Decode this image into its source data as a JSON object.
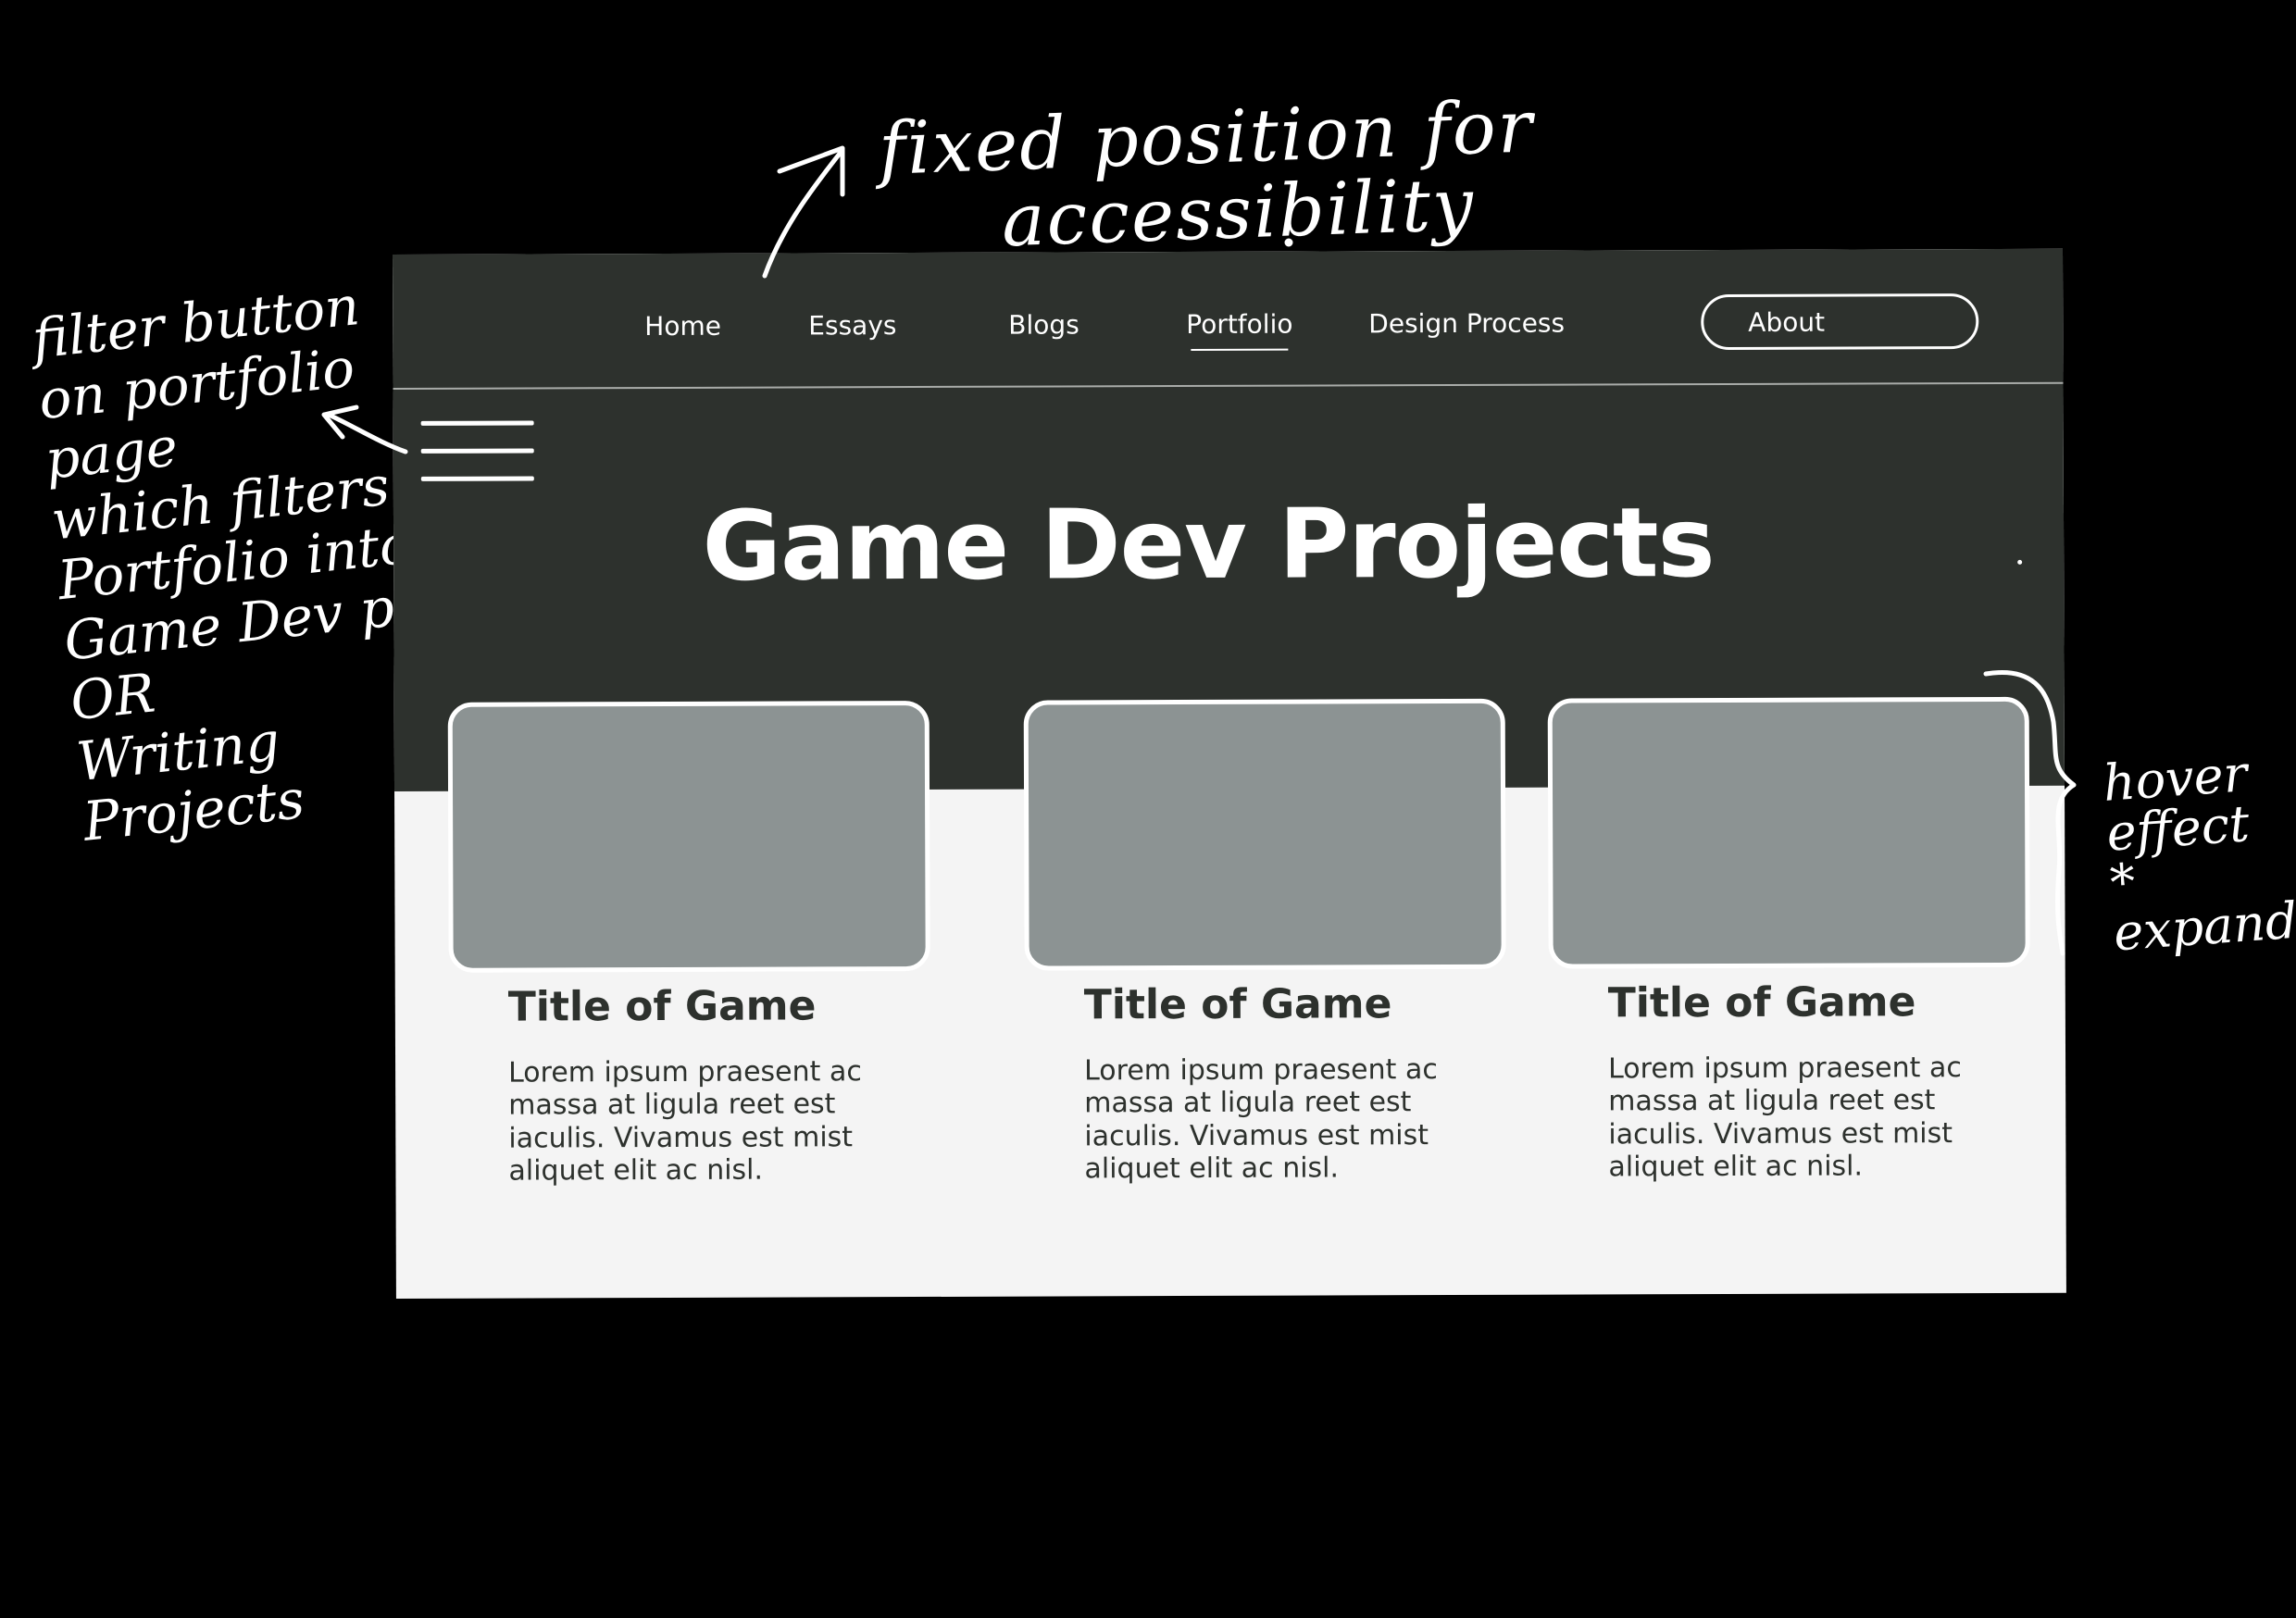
{
  "annotations": {
    "top_line1": "fixed position for",
    "top_line2": "accessibility",
    "left": "filter button\non portfolio\npage\nwhich filters\nPortfolio into\nGame Dev projects\nOR\nWriting\nProjects",
    "right": "hover\neffect\n* expands"
  },
  "nav": {
    "items": [
      {
        "label": "Home"
      },
      {
        "label": "Essays"
      },
      {
        "label": "Blogs"
      },
      {
        "label": "Portfolio",
        "active": true
      },
      {
        "label": "Design Process"
      }
    ],
    "about_label": "About"
  },
  "hero": {
    "title": "Game Dev Projects"
  },
  "cards": [
    {
      "title": "Title of Game",
      "description": "Lorem ipsum praesent ac massa at ligula reet est iaculis. Vivamus est mist aliquet elit ac nisl."
    },
    {
      "title": "Title of Game",
      "description": "Lorem ipsum praesent ac massa at ligula reet est iaculis. Vivamus est mist aliquet elit ac nisl."
    },
    {
      "title": "Title of Game",
      "description": "Lorem ipsum praesent ac massa at ligula reet est iaculis. Vivamus est mist aliquet elit ac nisl."
    }
  ],
  "colors": {
    "page_background": "#000000",
    "header_dark": "#2d312d",
    "content_light": "#f4f4f4",
    "card_image": "#8c9393",
    "text_light": "#ffffff"
  }
}
